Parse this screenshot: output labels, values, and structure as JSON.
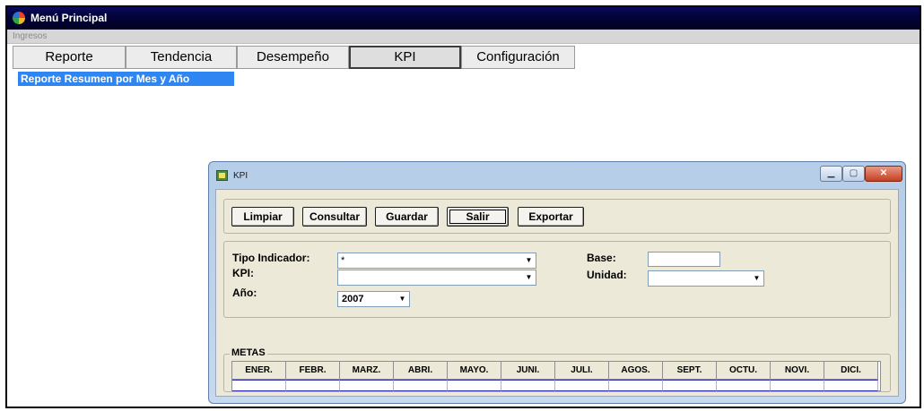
{
  "app": {
    "title": "Menú Principal"
  },
  "menu": {
    "items": [
      "Ingresos"
    ]
  },
  "tabs": [
    {
      "label": "Reporte"
    },
    {
      "label": "Tendencia"
    },
    {
      "label": "Desempeño"
    },
    {
      "label": "KPI",
      "active": true
    },
    {
      "label": "Configuración"
    }
  ],
  "sublink": {
    "label": "Reporte Resumen por Mes y Año"
  },
  "kpi_window": {
    "title": "KPI",
    "buttons": {
      "limpiar": "Limpiar",
      "consultar": "Consultar",
      "guardar": "Guardar",
      "salir": "Salir",
      "exportar": "Exportar"
    },
    "form": {
      "tipo_indicador_label": "Tipo Indicador:",
      "tipo_indicador_value": "*",
      "kpi_label": "KPI:",
      "kpi_value": "",
      "anio_label": "Año:",
      "anio_value": "2007",
      "base_label": "Base:",
      "base_value": "",
      "unidad_label": "Unidad:",
      "unidad_value": ""
    },
    "metas": {
      "title": "METAS",
      "columns": [
        "ENER.",
        "FEBR.",
        "MARZ.",
        "ABRI.",
        "MAYO.",
        "JUNI.",
        "JULI.",
        "AGOS.",
        "SEPT.",
        "OCTU.",
        "NOVI.",
        "DICI."
      ]
    }
  },
  "icons": {
    "app": "app-logo-icon",
    "window": "kpi-window-icon",
    "dropdown": "chevron-down-icon"
  }
}
